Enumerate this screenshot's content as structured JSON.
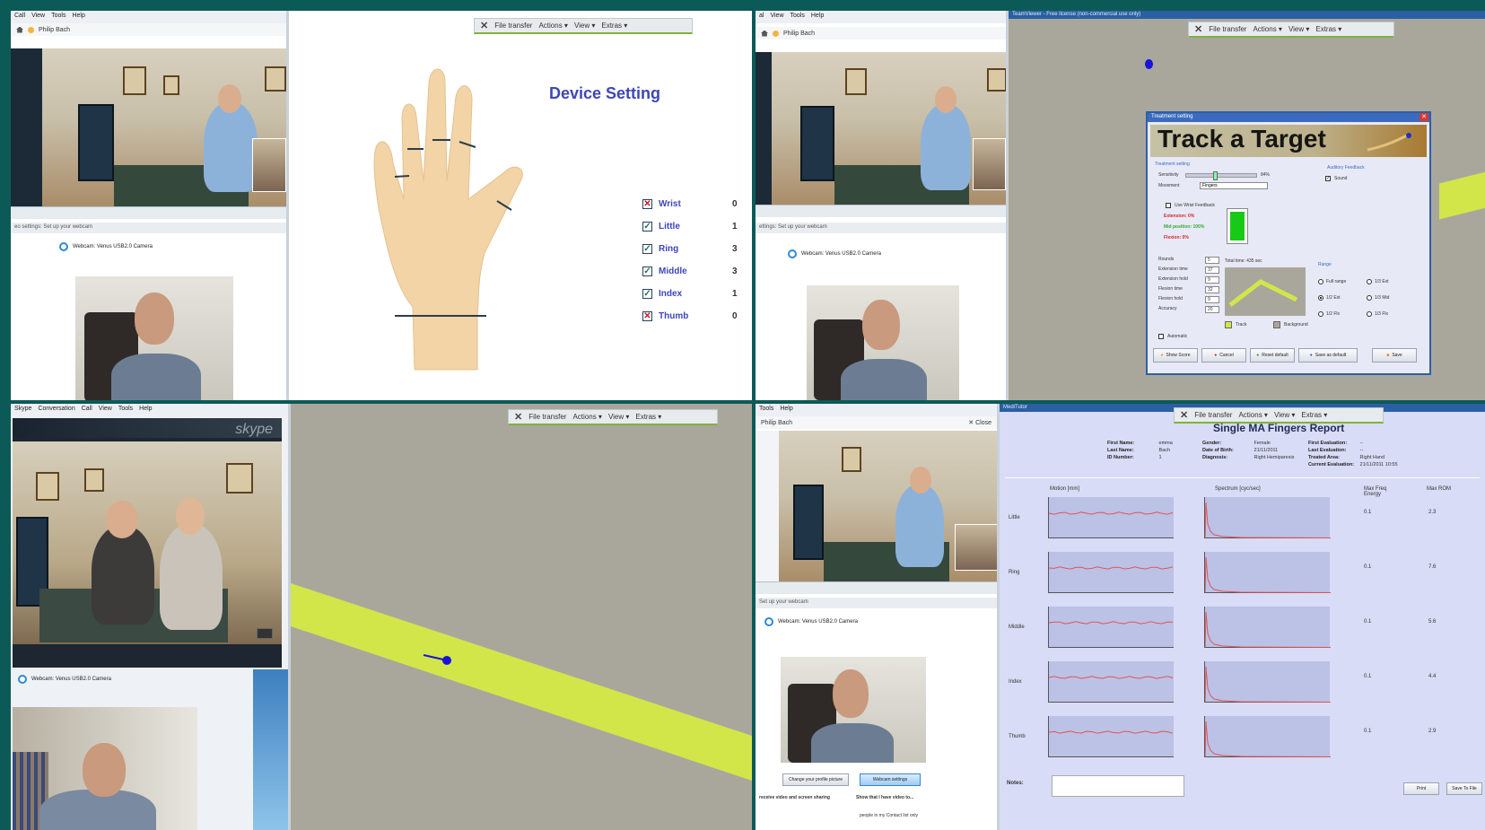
{
  "tl": {
    "skype_menu": [
      "Call",
      "View",
      "Tools",
      "Help"
    ],
    "contact": "Philip Bach",
    "settings_text": "eo settings: Set up your webcam",
    "webcam_label": "Webcam: Venus USB2.0 Camera"
  },
  "teamviewer_toolbar": {
    "close": "✕",
    "items": [
      "File transfer",
      "Actions ▾",
      "View ▾",
      "Extras ▾"
    ]
  },
  "device": {
    "title": "Device Setting",
    "fingers": [
      {
        "name": "Wrist",
        "checked": false,
        "count": "0"
      },
      {
        "name": "Little",
        "checked": true,
        "count": "1"
      },
      {
        "name": "Ring",
        "checked": true,
        "count": "3"
      },
      {
        "name": "Middle",
        "checked": true,
        "count": "3"
      },
      {
        "name": "Index",
        "checked": true,
        "count": "1"
      },
      {
        "name": "Thumb",
        "checked": false,
        "count": "0"
      }
    ]
  },
  "tr": {
    "skype_menu": [
      "al",
      "View",
      "Tools",
      "Help"
    ],
    "contact": "Philip Bach",
    "settings_text": "ettings: Set up your webcam",
    "webcam_label": "Webcam: Venus USB2.0 Camera",
    "tv_title": "TeamViewer - Free license (non-commercial use only)"
  },
  "treatment": {
    "window_title": "Treatment setting",
    "banner": "Track a Target",
    "section": "Treatment setting",
    "sensitivity_label": "Sensitivity",
    "sensitivity_value": "84%",
    "movement_label": "Movement",
    "movement_value": "Fingers",
    "auditory_label": "Auditory Feedback",
    "sound_label": "Sound",
    "wrist_feedback": "Use Wrist Feedback",
    "extension": "Extension: 0%",
    "mid_position": "Mid position: 100%",
    "flexion": "Flexion: 0%",
    "params": [
      {
        "label": "Rounds",
        "value": "5"
      },
      {
        "label": "Extension time",
        "value": "37"
      },
      {
        "label": "Extension hold",
        "value": "9"
      },
      {
        "label": "Flexion time",
        "value": "32"
      },
      {
        "label": "Flexion hold",
        "value": "9"
      },
      {
        "label": "Accuracy",
        "value": "20"
      }
    ],
    "total_time": "Total time: 435 sec",
    "range_label": "Range",
    "range_opts": [
      "Full range",
      "1/3 Ext",
      "1/2 Ext",
      "1/3 Mid",
      "1/2 Flx",
      "1/3 Flx"
    ],
    "track_label": "Track",
    "background_label": "Background",
    "automatic_label": "Automatic",
    "buttons": [
      "Show Score",
      "Cancel",
      "Reset default",
      "Save as default",
      "Save"
    ]
  },
  "bl": {
    "skype_menu": [
      "Skype",
      "Conversation",
      "Call",
      "View",
      "Tools",
      "Help"
    ],
    "skype_logo": "skype",
    "webcam_label": "Webcam: Venus USB2.0 Camera"
  },
  "br": {
    "skype_menu": [
      "Tools",
      "Help"
    ],
    "contact": "Philip Bach",
    "close_label": "✕ Close",
    "settings_text": "Set up your webcam",
    "webcam_label": "Webcam: Venus USB2.0 Camera",
    "change_picture": "Change your profile picture",
    "webcam_settings": "Webcam settings",
    "receive_text": "receive video and screen sharing",
    "show_text": "Show that I have video to...",
    "contacts_only": "people in my Contact list only",
    "tv_title": "MediTutor"
  },
  "report": {
    "title": "Single MA Fingers Report",
    "fields1": [
      {
        "k": "First Name:",
        "v": "emma"
      },
      {
        "k": "Last Name:",
        "v": "Bach"
      },
      {
        "k": "ID Number:",
        "v": "1"
      }
    ],
    "fields2": [
      {
        "k": "Gender:",
        "v": "Female"
      },
      {
        "k": "Date of Birth:",
        "v": "21/11/2011"
      },
      {
        "k": "Diagnosis:",
        "v": "Right Hemiparesis"
      }
    ],
    "fields3": [
      {
        "k": "First Evaluation:",
        "v": "--"
      },
      {
        "k": "Last Evaluation:",
        "v": "--"
      },
      {
        "k": "Treated Area:",
        "v": "Right Hand"
      },
      {
        "k": "Current Evaluation:",
        "v": "21/11/2011 10:55"
      }
    ],
    "col_motion": "Motion [mm]",
    "col_spectrum": "Spectrum [cyc/sec]",
    "col_freq": "Max Freq Energy",
    "col_rom": "Max ROM",
    "rows": [
      {
        "label": "Little",
        "freq": "0.1",
        "rom": "2.3"
      },
      {
        "label": "Ring",
        "freq": "0.1",
        "rom": "7.6"
      },
      {
        "label": "Middle",
        "freq": "0.1",
        "rom": "5.6"
      },
      {
        "label": "Index",
        "freq": "0.1",
        "rom": "4.4"
      },
      {
        "label": "Thumb",
        "freq": "0.1",
        "rom": "2.9"
      }
    ],
    "notes_label": "Notes:",
    "print_btn": "Print",
    "save_btn": "Save To File"
  },
  "colors": {
    "teal_border": "#0c5a57",
    "track_green": "#d2e64a",
    "target_blue": "#1a12d9",
    "report_bg": "#d8dcf6"
  }
}
